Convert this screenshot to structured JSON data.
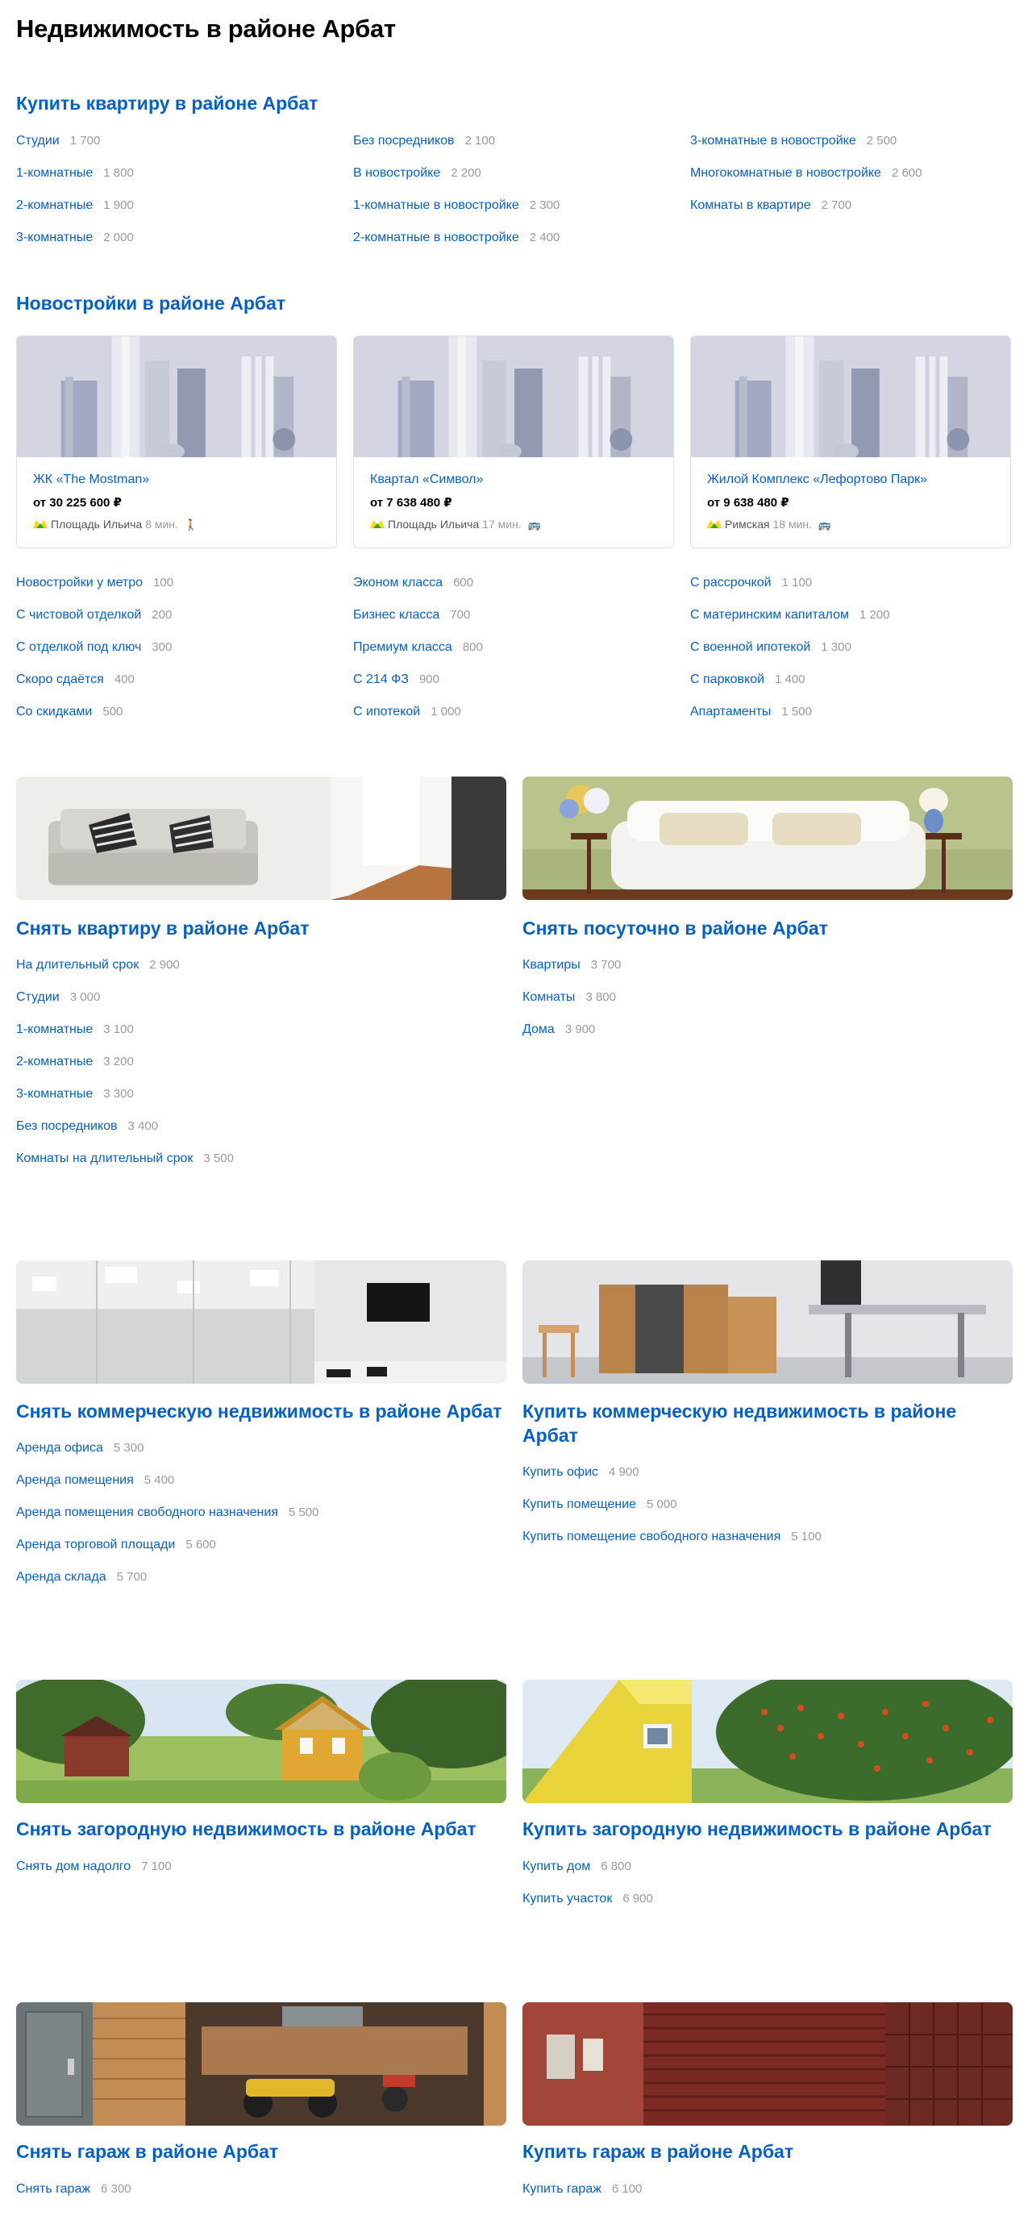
{
  "title": "Недвижимость в районе Арбат",
  "buy": {
    "heading": "Купить квартиру в районе Арбат",
    "links": [
      {
        "label": "Студии",
        "count": "1 700"
      },
      {
        "label": "1-комнатные",
        "count": "1 800"
      },
      {
        "label": "2-комнатные",
        "count": "1 900"
      },
      {
        "label": "3-комнатные",
        "count": "2 000"
      },
      {
        "label": "Без посредников",
        "count": "2 100"
      },
      {
        "label": "В новостройке",
        "count": "2 200"
      },
      {
        "label": "1-комнатные в новостройке",
        "count": "2 300"
      },
      {
        "label": "2-комнатные в новостройке",
        "count": "2 400"
      },
      {
        "label": "3-комнатные в новостройке",
        "count": "2 500"
      },
      {
        "label": "Многокомнатные в новостройке",
        "count": "2 600"
      },
      {
        "label": "Комнаты в квартире",
        "count": "2 700"
      }
    ]
  },
  "newbuild": {
    "heading": "Новостройки в районе Арбат",
    "cards": [
      {
        "name": "ЖК «The Mostman»",
        "price": "от 30 225 600 ₽",
        "metro": "Площадь Ильича",
        "time": "8 мин.",
        "transport": "walk-icon",
        "glyph": "🚶"
      },
      {
        "name": "Квартал «Символ»",
        "price": "от 7 638 480 ₽",
        "metro": "Площадь Ильича",
        "time": "17 мин.",
        "transport": "bus-icon",
        "glyph": "🚌"
      },
      {
        "name": "Жилой Комплекс «Лефортово Парк»",
        "price": "от 9 638 480 ₽",
        "metro": "Римская",
        "time": "18 мин.",
        "transport": "bus-icon",
        "glyph": "🚌"
      }
    ],
    "links": [
      {
        "label": "Новостройки у метро",
        "count": "100"
      },
      {
        "label": "С чистовой отделкой",
        "count": "200"
      },
      {
        "label": "С отделкой под ключ",
        "count": "300"
      },
      {
        "label": "Скоро сдаётся",
        "count": "400"
      },
      {
        "label": "Со скидками",
        "count": "500"
      },
      {
        "label": "Эконом класса",
        "count": "600"
      },
      {
        "label": "Бизнес класса",
        "count": "700"
      },
      {
        "label": "Премиум класса",
        "count": "800"
      },
      {
        "label": "С 214 ФЗ",
        "count": "900"
      },
      {
        "label": "С ипотекой",
        "count": "1 000"
      },
      {
        "label": "С рассрочкой",
        "count": "1 100"
      },
      {
        "label": "С материнским капиталом",
        "count": "1 200"
      },
      {
        "label": "С военной ипотекой",
        "count": "1 300"
      },
      {
        "label": "С парковкой",
        "count": "1 400"
      },
      {
        "label": "Апартаменты",
        "count": "1 500"
      }
    ]
  },
  "rent": {
    "heading": "Снять квартиру в районе Арбат",
    "links": [
      {
        "label": "На длительный срок",
        "count": "2 900"
      },
      {
        "label": "Студии",
        "count": "3 000"
      },
      {
        "label": "1-комнатные",
        "count": "3 100"
      },
      {
        "label": "2-комнатные",
        "count": "3 200"
      },
      {
        "label": "3-комнатные",
        "count": "3 300"
      },
      {
        "label": "Без посредников",
        "count": "3 400"
      },
      {
        "label": "Комнаты на длительный срок",
        "count": "3 500"
      }
    ]
  },
  "daily": {
    "heading": "Снять посуточно в районе Арбат",
    "links": [
      {
        "label": "Квартиры",
        "count": "3 700"
      },
      {
        "label": "Комнаты",
        "count": "3 800"
      },
      {
        "label": "Дома",
        "count": "3 900"
      }
    ]
  },
  "commercial_rent": {
    "heading": "Снять коммерческую недвижимость в районе Арбат",
    "links": [
      {
        "label": "Аренда офиса",
        "count": "5 300"
      },
      {
        "label": "Аренда помещения",
        "count": "5 400"
      },
      {
        "label": "Аренда помещения свободного назначения",
        "count": "5 500"
      },
      {
        "label": "Аренда торговой площади",
        "count": "5 600"
      },
      {
        "label": "Аренда склада",
        "count": "5 700"
      }
    ]
  },
  "commercial_buy": {
    "heading": "Купить коммерческую недвижимость в районе Арбат",
    "links": [
      {
        "label": "Купить офис",
        "count": "4 900"
      },
      {
        "label": "Купить помещение",
        "count": "5 000"
      },
      {
        "label": "Купить помещение свободного назначения",
        "count": "5 100"
      }
    ]
  },
  "country_rent": {
    "heading": "Снять загородную недвижимость в районе Арбат",
    "links": [
      {
        "label": "Снять дом надолго",
        "count": "7 100"
      }
    ]
  },
  "country_buy": {
    "heading": "Купить загородную недвижимость в районе Арбат",
    "links": [
      {
        "label": "Купить дом",
        "count": "6 800"
      },
      {
        "label": "Купить участок",
        "count": "6 900"
      }
    ]
  },
  "garage_rent": {
    "heading": "Снять гараж в районе Арбат",
    "links": [
      {
        "label": "Снять гараж",
        "count": "6 300"
      }
    ]
  },
  "garage_buy": {
    "heading": "Купить гараж в районе Арбат",
    "links": [
      {
        "label": "Купить гараж",
        "count": "6 100"
      }
    ]
  },
  "colors": {
    "link": "#0660c9",
    "count": "#999999",
    "metro_yellow": "#ffd800",
    "metro_green": "#26a93c"
  }
}
